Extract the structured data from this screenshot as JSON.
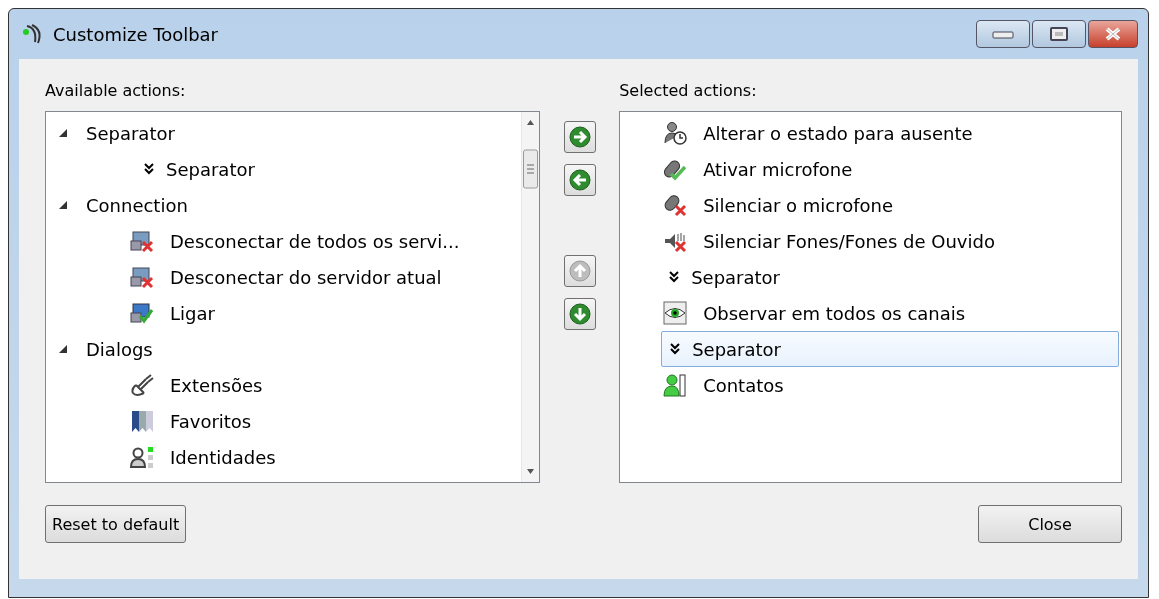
{
  "window": {
    "title": "Customize Toolbar"
  },
  "available": {
    "label": "Available actions:",
    "groups": [
      {
        "label": "Separator",
        "expanded": true,
        "children": [
          {
            "label": "Separator",
            "kind": "separator",
            "selected": false
          }
        ]
      },
      {
        "label": "Connection",
        "expanded": true,
        "children": [
          {
            "label": "Desconectar de todos os servi...",
            "kind": "disconnect",
            "selected": false
          },
          {
            "label": "Desconectar do servidor atual",
            "kind": "disconnect",
            "selected": false
          },
          {
            "label": "Ligar",
            "kind": "connect",
            "selected": false
          }
        ]
      },
      {
        "label": "Dialogs",
        "expanded": true,
        "children": [
          {
            "label": "Extensões",
            "kind": "plugin",
            "selected": false
          },
          {
            "label": "Favoritos",
            "kind": "bookmarks",
            "selected": false
          },
          {
            "label": "Identidades",
            "kind": "identity",
            "selected": false
          }
        ]
      }
    ]
  },
  "move_buttons": [
    {
      "kind": "right",
      "disabled": false
    },
    {
      "kind": "left",
      "disabled": false
    },
    {
      "kind": "up",
      "disabled": true
    },
    {
      "kind": "down",
      "disabled": false
    }
  ],
  "selected": {
    "label": "Selected actions:",
    "items": [
      {
        "label": "Alterar o estado para ausente",
        "kind": "away",
        "selected": false
      },
      {
        "label": "Ativar microfone",
        "kind": "mic-on",
        "selected": false
      },
      {
        "label": "Silenciar o microfone",
        "kind": "mic-off",
        "selected": false
      },
      {
        "label": "Silenciar Fones/Fones de Ouvido",
        "kind": "headphones-off",
        "selected": false
      },
      {
        "label": "Separator",
        "kind": "separator",
        "selected": false
      },
      {
        "label": "Observar em todos os canais",
        "kind": "watch",
        "selected": false
      },
      {
        "label": "Separator",
        "kind": "separator",
        "selected": true
      },
      {
        "label": "Contatos",
        "kind": "contacts",
        "selected": false
      }
    ]
  },
  "buttons": {
    "reset": "Reset to default",
    "close": "Close"
  }
}
